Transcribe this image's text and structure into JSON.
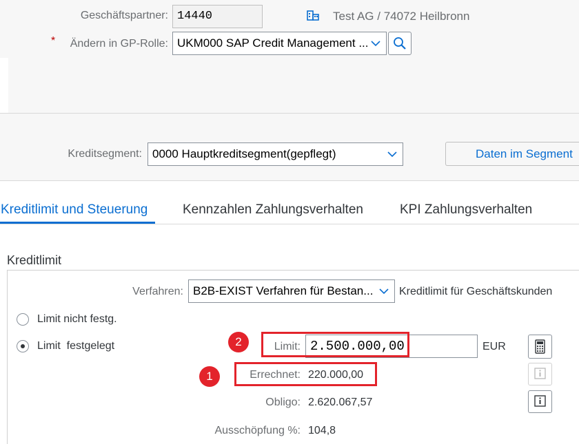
{
  "header": {
    "gp_label": "Geschäftspartner:",
    "gp_value": "14440",
    "gp_description": "Test AG / 74072 Heilbronn",
    "role_required_mark": "*",
    "role_label": "Ändern in GP-Rolle:",
    "role_value": "UKM000 SAP Credit Management ..."
  },
  "segment": {
    "label": "Kreditsegment:",
    "value": "0000 Hauptkreditsegment(gepflegt)",
    "button_label": "Daten im Segment"
  },
  "tabs": [
    {
      "label": "Kreditlimit und Steuerung",
      "active": true
    },
    {
      "label": "Kennzahlen Zahlungsverhalten",
      "active": false
    },
    {
      "label": "KPI Zahlungsverhalten",
      "active": false
    }
  ],
  "kreditlimit": {
    "section_title": "Kreditlimit",
    "verfahren_label": "Verfahren:",
    "verfahren_value": "B2B-EXIST Verfahren für Bestan...",
    "verfahren_description": "Kreditlimit für Geschäftskunden",
    "radio_not_set": "Limit nicht festg.",
    "radio_set": "Limit  festgelegt",
    "limit_label": "Limit:",
    "limit_value": "2.500.000,00",
    "currency": "EUR",
    "errechnet_label": "Errechnet:",
    "errechnet_value": "220.000,00",
    "obligo_label": "Obligo:",
    "obligo_value": "2.620.067,57",
    "ausschoepfung_label": "Ausschöpfung %:",
    "ausschoepfung_value": "104,8"
  },
  "annotations": {
    "badge_1": "1",
    "badge_2": "2",
    "highlight_color": "#e3232b"
  },
  "icons": [
    "building-icon",
    "search-icon",
    "calculator-icon",
    "info-icon"
  ]
}
